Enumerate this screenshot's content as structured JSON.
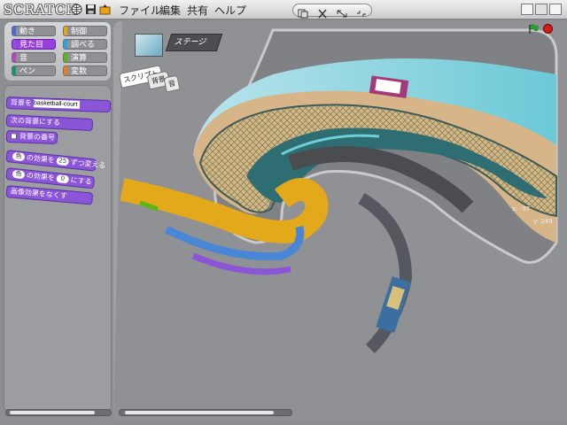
{
  "app": {
    "logo": "SCRATCH"
  },
  "menu": {
    "file": "ファイル",
    "edit": "編集",
    "share": "共有",
    "help": "ヘルプ"
  },
  "toolbar_icons": [
    "globe-icon",
    "save-icon",
    "share-icon"
  ],
  "palette": {
    "categories": [
      {
        "label": "動き",
        "color": "#4a6cd4"
      },
      {
        "label": "制御",
        "color": "#e1a91a"
      },
      {
        "label": "見た目",
        "color": "#8a55d6",
        "selected": true
      },
      {
        "label": "調べる",
        "color": "#2ca5e2"
      },
      {
        "label": "音",
        "color": "#bb42c3"
      },
      {
        "label": "演算",
        "color": "#5cb712"
      },
      {
        "label": "ペン",
        "color": "#0e9a6c"
      },
      {
        "label": "変数",
        "color": "#ee7d16"
      }
    ]
  },
  "blocks": {
    "switch_backdrop": "背景を",
    "backdrop_value": "basketball-court",
    "next_backdrop": "次の背景にする",
    "backdrop_number": "背景の番号",
    "color1_prefix": "色",
    "color1_mid": "の効果を",
    "color1_value": "25",
    "color1_suffix": "ずつ変える",
    "color2_prefix": "色",
    "color2_mid": "の効果を",
    "color2_value": "0",
    "color2_suffix": "にする",
    "clear_effects": "画像効果をなくす"
  },
  "sprite": {
    "name": "ステージ"
  },
  "tabs": [
    {
      "label": "スクリプト"
    },
    {
      "label": "背景"
    },
    {
      "label": "音"
    }
  ],
  "stage": {
    "x_label": "x: -37",
    "y_label": "y: 249"
  },
  "colors": {
    "accent": "#8a55d6",
    "stop": "#d71b1b",
    "flag": "#28a52d"
  }
}
